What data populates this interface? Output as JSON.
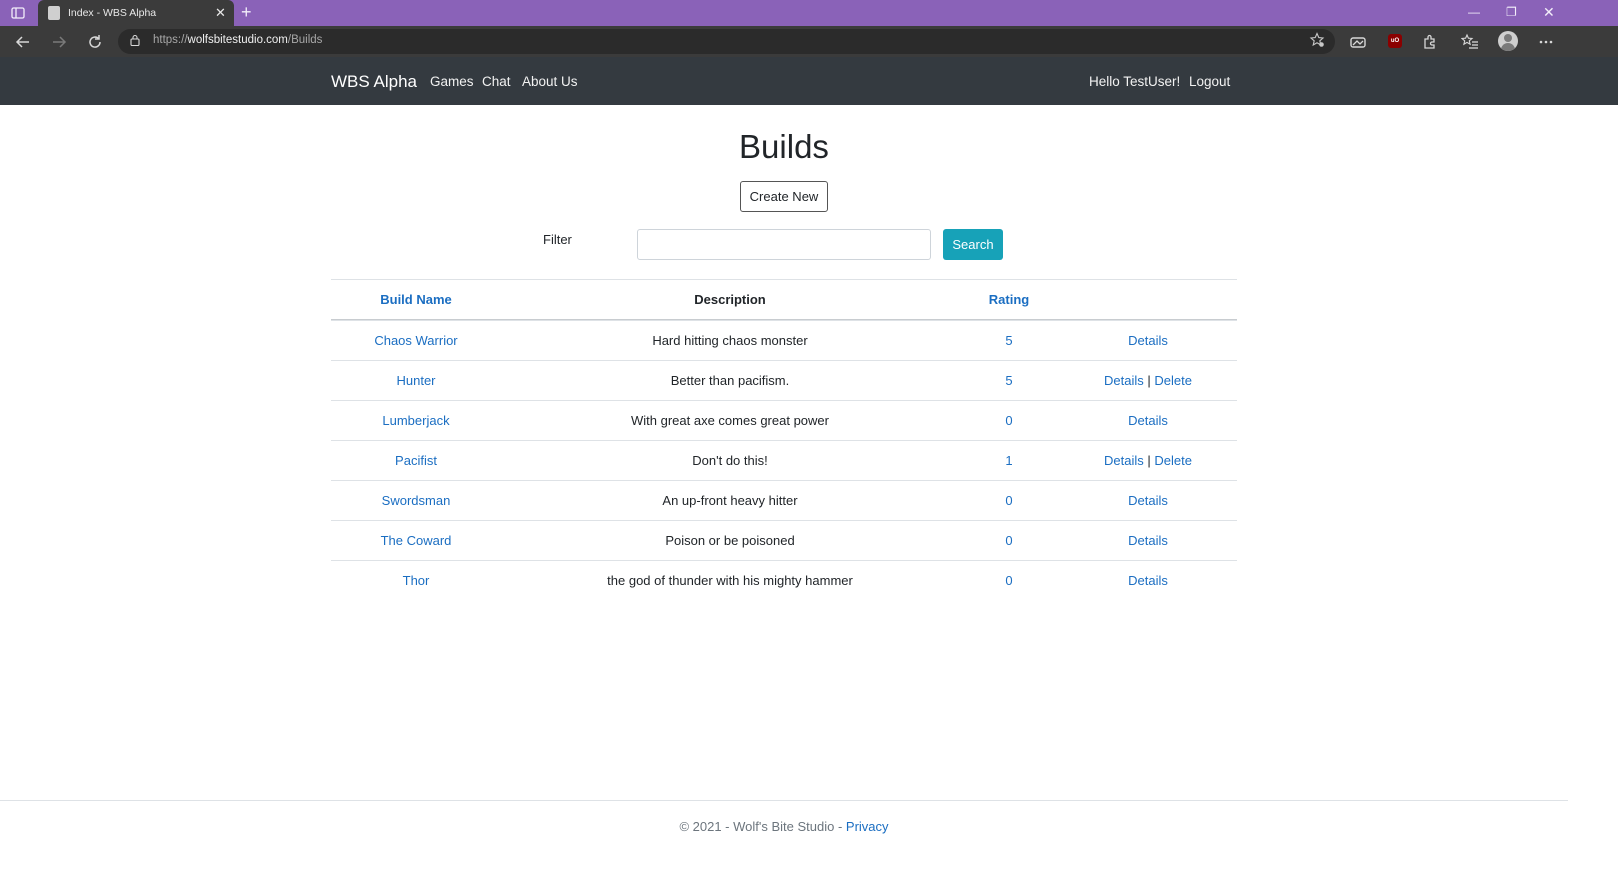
{
  "browser": {
    "tab_title": "Index - WBS Alpha",
    "tab_close": "✕",
    "new_tab": "+",
    "url_scheme": "https://",
    "url_host": "wolfsbitestudio.com",
    "url_path": "/Builds",
    "window_min": "—",
    "window_max": "❐",
    "window_close": "✕",
    "extension_badge": "uO"
  },
  "navbar": {
    "brand": "WBS Alpha",
    "links": [
      "Games",
      "Chat",
      "About Us"
    ],
    "greeting": "Hello TestUser!",
    "logout": "Logout"
  },
  "page": {
    "title": "Builds",
    "create_new": "Create New",
    "filter_label": "Filter",
    "filter_value": "",
    "search_button": "Search"
  },
  "table": {
    "headers": {
      "name": "Build Name",
      "description": "Description",
      "rating": "Rating"
    },
    "rows": [
      {
        "name": "Chaos Warrior",
        "description": "Hard hitting chaos monster",
        "rating": "5",
        "details": "Details",
        "delete": ""
      },
      {
        "name": "Hunter",
        "description": "Better than pacifism.",
        "rating": "5",
        "details": "Details",
        "delete": "Delete"
      },
      {
        "name": "Lumberjack",
        "description": "With great axe comes great power",
        "rating": "0",
        "details": "Details",
        "delete": ""
      },
      {
        "name": "Pacifist",
        "description": "Don't do this!",
        "rating": "1",
        "details": "Details",
        "delete": "Delete"
      },
      {
        "name": "Swordsman",
        "description": "An up-front heavy hitter",
        "rating": "0",
        "details": "Details",
        "delete": ""
      },
      {
        "name": "The Coward",
        "description": "Poison or be poisoned",
        "rating": "0",
        "details": "Details",
        "delete": ""
      },
      {
        "name": "Thor",
        "description": "the god of thunder with his mighty hammer",
        "rating": "0",
        "details": "Details",
        "delete": ""
      }
    ]
  },
  "footer": {
    "text": "© 2021 - Wolf's Bite Studio - ",
    "privacy": "Privacy"
  },
  "colors": {
    "tabstrip": "#8a62b8",
    "navbar": "#343a40",
    "link": "#1b6ec2",
    "search_button": "#17a2b8"
  }
}
